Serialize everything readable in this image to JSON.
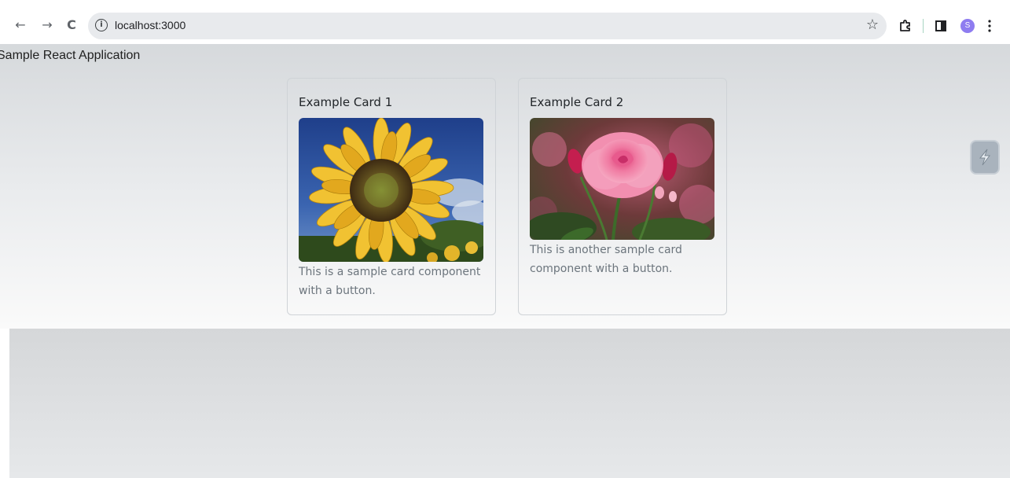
{
  "browser": {
    "url": "localhost:3000",
    "back_icon": "←",
    "forward_icon": "→",
    "reload_icon": "C",
    "info_icon": "i",
    "bookmark_icon": "☆",
    "profile_initial": "S"
  },
  "page": {
    "app_title": "Sample React Application"
  },
  "cards": [
    {
      "title": "Example Card 1",
      "image": "sunflower",
      "text": "This is a sample card component with a button."
    },
    {
      "title": "Example Card 2",
      "image": "pink-rose",
      "text": "This is another sample card component with a button."
    }
  ],
  "colors": {
    "avatar": "#8e7cf0",
    "card_border": "#cfd3d7",
    "card_text": "#6c757d"
  }
}
